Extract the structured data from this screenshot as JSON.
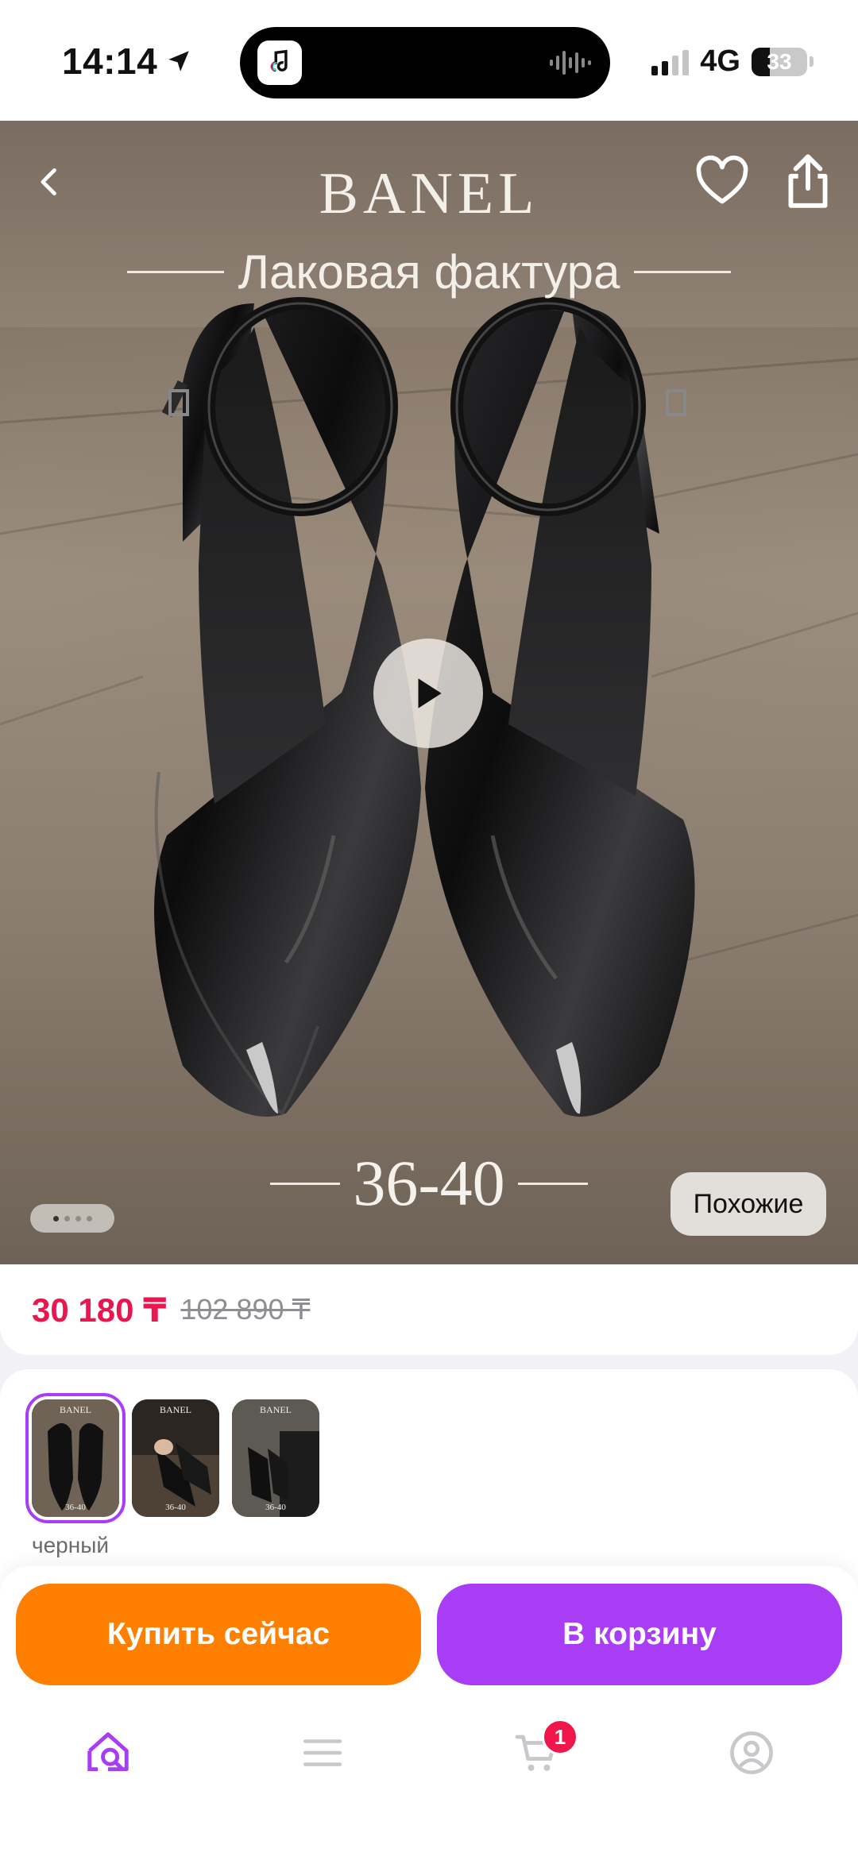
{
  "status_bar": {
    "time": "14:14",
    "network": "4G",
    "battery": "33",
    "location_icon": "location-arrow-icon",
    "island_app_icon": "music-app-icon"
  },
  "hero": {
    "brand": "BANEL",
    "subtitle": "Лаковая фактура",
    "size_range": "36-40",
    "similar_button": "Похожие",
    "carousel_pages": 4,
    "carousel_active": 1,
    "icons": {
      "back": "chevron-left-icon",
      "favorite": "heart-icon",
      "share": "share-icon",
      "play": "play-icon"
    }
  },
  "price": {
    "current": "30 180 ₸",
    "old": "102 890 ₸",
    "current_color": "#e8174f"
  },
  "variants": {
    "thumbnails": [
      {
        "brand": "BANEL",
        "size": "36-40",
        "selected": true
      },
      {
        "brand": "BANEL",
        "size": "36-40",
        "selected": false
      },
      {
        "brand": "BANEL",
        "size": "36-40",
        "selected": false
      }
    ],
    "color_name": "черный",
    "selected_color": "#a93cf5"
  },
  "actions": {
    "buy_now": "Купить сейчас",
    "add_to_cart": "В корзину",
    "buy_color": "#ff7f00",
    "cart_color": "#a93cf5"
  },
  "tabbar": {
    "items": [
      {
        "name": "home-search-icon",
        "active": true
      },
      {
        "name": "menu-icon",
        "active": false
      },
      {
        "name": "cart-icon",
        "active": false,
        "badge": "1"
      },
      {
        "name": "profile-icon",
        "active": false
      }
    ],
    "active_color": "#a93cf5",
    "inactive_color": "#c7c7cc"
  }
}
